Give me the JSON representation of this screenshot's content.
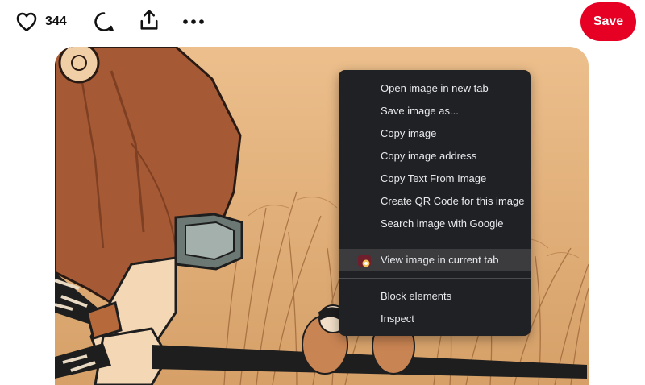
{
  "toolbar": {
    "like_count": "344",
    "like_icon": "heart-icon",
    "comment_icon": "comment-icon",
    "share_icon": "share-icon",
    "more_icon": "more-icon",
    "save_label": "Save",
    "save_color": "#e60023"
  },
  "context_menu": {
    "items": [
      {
        "label": "Open image in new tab"
      },
      {
        "label": "Save image as..."
      },
      {
        "label": "Copy image"
      },
      {
        "label": "Copy image address"
      },
      {
        "label": "Copy Text From Image"
      },
      {
        "label": "Create QR Code for this image"
      },
      {
        "label": "Search image with Google"
      }
    ],
    "extension_item": {
      "label": "View image in current tab",
      "icon": "extension-icon"
    },
    "footer_items": [
      {
        "label": "Block elements"
      },
      {
        "label": "Inspect"
      }
    ]
  }
}
